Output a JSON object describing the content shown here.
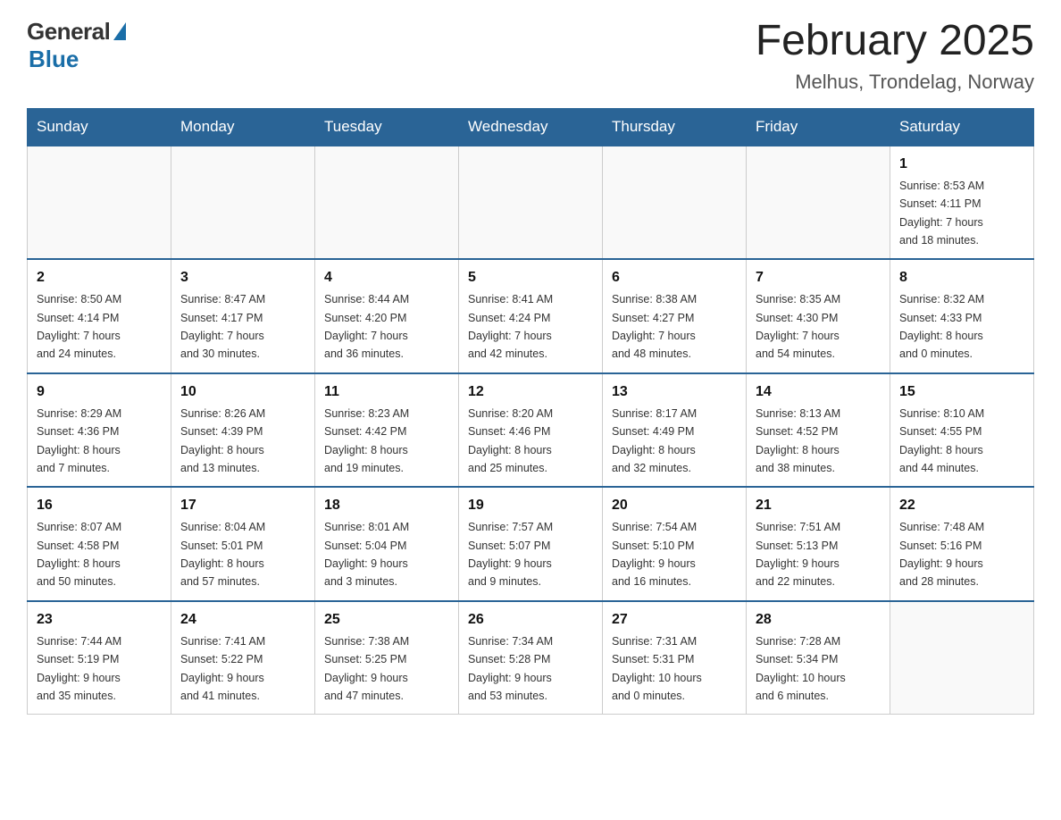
{
  "header": {
    "logo_general": "General",
    "logo_blue": "Blue",
    "month_title": "February 2025",
    "location": "Melhus, Trondelag, Norway"
  },
  "weekdays": [
    "Sunday",
    "Monday",
    "Tuesday",
    "Wednesday",
    "Thursday",
    "Friday",
    "Saturday"
  ],
  "weeks": [
    [
      {
        "day": "",
        "info": ""
      },
      {
        "day": "",
        "info": ""
      },
      {
        "day": "",
        "info": ""
      },
      {
        "day": "",
        "info": ""
      },
      {
        "day": "",
        "info": ""
      },
      {
        "day": "",
        "info": ""
      },
      {
        "day": "1",
        "info": "Sunrise: 8:53 AM\nSunset: 4:11 PM\nDaylight: 7 hours\nand 18 minutes."
      }
    ],
    [
      {
        "day": "2",
        "info": "Sunrise: 8:50 AM\nSunset: 4:14 PM\nDaylight: 7 hours\nand 24 minutes."
      },
      {
        "day": "3",
        "info": "Sunrise: 8:47 AM\nSunset: 4:17 PM\nDaylight: 7 hours\nand 30 minutes."
      },
      {
        "day": "4",
        "info": "Sunrise: 8:44 AM\nSunset: 4:20 PM\nDaylight: 7 hours\nand 36 minutes."
      },
      {
        "day": "5",
        "info": "Sunrise: 8:41 AM\nSunset: 4:24 PM\nDaylight: 7 hours\nand 42 minutes."
      },
      {
        "day": "6",
        "info": "Sunrise: 8:38 AM\nSunset: 4:27 PM\nDaylight: 7 hours\nand 48 minutes."
      },
      {
        "day": "7",
        "info": "Sunrise: 8:35 AM\nSunset: 4:30 PM\nDaylight: 7 hours\nand 54 minutes."
      },
      {
        "day": "8",
        "info": "Sunrise: 8:32 AM\nSunset: 4:33 PM\nDaylight: 8 hours\nand 0 minutes."
      }
    ],
    [
      {
        "day": "9",
        "info": "Sunrise: 8:29 AM\nSunset: 4:36 PM\nDaylight: 8 hours\nand 7 minutes."
      },
      {
        "day": "10",
        "info": "Sunrise: 8:26 AM\nSunset: 4:39 PM\nDaylight: 8 hours\nand 13 minutes."
      },
      {
        "day": "11",
        "info": "Sunrise: 8:23 AM\nSunset: 4:42 PM\nDaylight: 8 hours\nand 19 minutes."
      },
      {
        "day": "12",
        "info": "Sunrise: 8:20 AM\nSunset: 4:46 PM\nDaylight: 8 hours\nand 25 minutes."
      },
      {
        "day": "13",
        "info": "Sunrise: 8:17 AM\nSunset: 4:49 PM\nDaylight: 8 hours\nand 32 minutes."
      },
      {
        "day": "14",
        "info": "Sunrise: 8:13 AM\nSunset: 4:52 PM\nDaylight: 8 hours\nand 38 minutes."
      },
      {
        "day": "15",
        "info": "Sunrise: 8:10 AM\nSunset: 4:55 PM\nDaylight: 8 hours\nand 44 minutes."
      }
    ],
    [
      {
        "day": "16",
        "info": "Sunrise: 8:07 AM\nSunset: 4:58 PM\nDaylight: 8 hours\nand 50 minutes."
      },
      {
        "day": "17",
        "info": "Sunrise: 8:04 AM\nSunset: 5:01 PM\nDaylight: 8 hours\nand 57 minutes."
      },
      {
        "day": "18",
        "info": "Sunrise: 8:01 AM\nSunset: 5:04 PM\nDaylight: 9 hours\nand 3 minutes."
      },
      {
        "day": "19",
        "info": "Sunrise: 7:57 AM\nSunset: 5:07 PM\nDaylight: 9 hours\nand 9 minutes."
      },
      {
        "day": "20",
        "info": "Sunrise: 7:54 AM\nSunset: 5:10 PM\nDaylight: 9 hours\nand 16 minutes."
      },
      {
        "day": "21",
        "info": "Sunrise: 7:51 AM\nSunset: 5:13 PM\nDaylight: 9 hours\nand 22 minutes."
      },
      {
        "day": "22",
        "info": "Sunrise: 7:48 AM\nSunset: 5:16 PM\nDaylight: 9 hours\nand 28 minutes."
      }
    ],
    [
      {
        "day": "23",
        "info": "Sunrise: 7:44 AM\nSunset: 5:19 PM\nDaylight: 9 hours\nand 35 minutes."
      },
      {
        "day": "24",
        "info": "Sunrise: 7:41 AM\nSunset: 5:22 PM\nDaylight: 9 hours\nand 41 minutes."
      },
      {
        "day": "25",
        "info": "Sunrise: 7:38 AM\nSunset: 5:25 PM\nDaylight: 9 hours\nand 47 minutes."
      },
      {
        "day": "26",
        "info": "Sunrise: 7:34 AM\nSunset: 5:28 PM\nDaylight: 9 hours\nand 53 minutes."
      },
      {
        "day": "27",
        "info": "Sunrise: 7:31 AM\nSunset: 5:31 PM\nDaylight: 10 hours\nand 0 minutes."
      },
      {
        "day": "28",
        "info": "Sunrise: 7:28 AM\nSunset: 5:34 PM\nDaylight: 10 hours\nand 6 minutes."
      },
      {
        "day": "",
        "info": ""
      }
    ]
  ]
}
